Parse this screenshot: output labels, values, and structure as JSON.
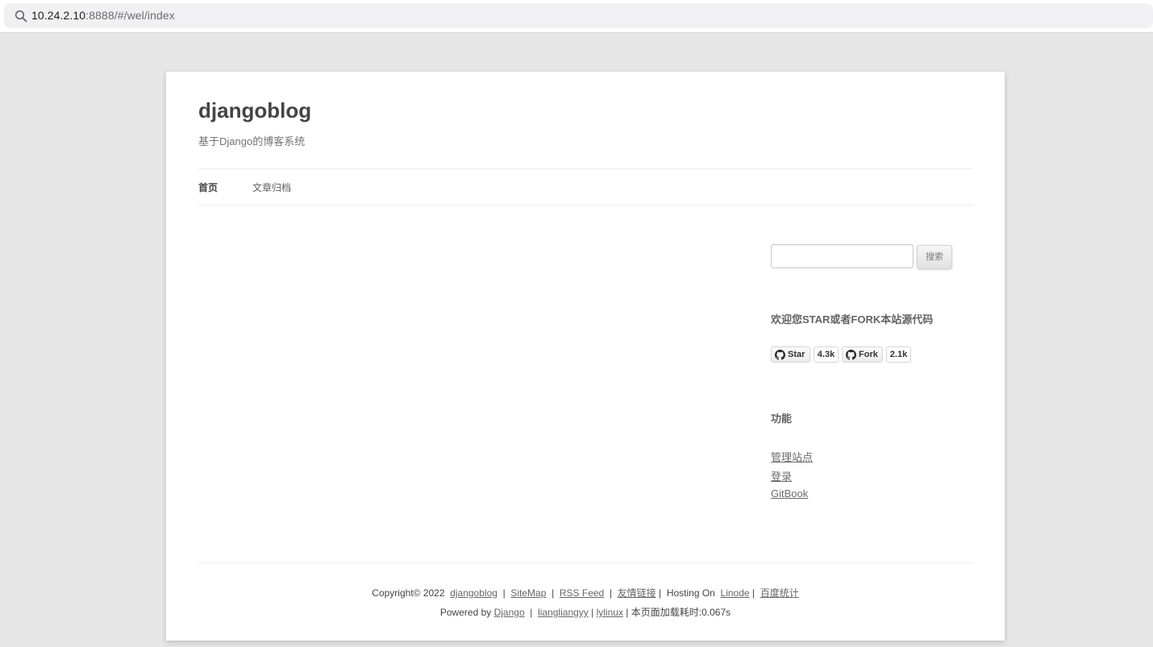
{
  "browser": {
    "url_host": "10.24.2.10",
    "url_rest": ":8888/#/wel/index"
  },
  "site": {
    "title": "djangoblog",
    "description": "基于Django的博客系统"
  },
  "nav": {
    "items": [
      {
        "label": "首页"
      },
      {
        "label": "文章归档"
      }
    ]
  },
  "sidebar": {
    "search": {
      "value": "",
      "button_label": "搜索"
    },
    "github_widget": {
      "title": "欢迎您STAR或者FORK本站源代码",
      "star_label": "Star",
      "star_count": "4.3k",
      "fork_label": "Fork",
      "fork_count": "2.1k"
    },
    "functions_widget": {
      "title": "功能",
      "links": [
        "管理站点",
        "登录",
        "GitBook"
      ]
    }
  },
  "footer": {
    "copyright_prefix": "Copyright© 2022",
    "site_link": "djangoblog",
    "sitemap_link": "SiteMap",
    "rss_link": "RSS Feed",
    "friends_link": "友情链接",
    "hosting_text": "Hosting On",
    "linode_link": "Linode",
    "baidu_link": "百度统计",
    "powered_by": "Powered by",
    "django_link": "Django",
    "author_link": "liangliangyy",
    "lylinux_link": "lylinux",
    "load_time": "本页面加载耗时:0.067s"
  },
  "colors": {
    "page_bg": "#e6e6e6",
    "card_bg": "#ffffff",
    "text": "#444444",
    "link": "#666666"
  }
}
